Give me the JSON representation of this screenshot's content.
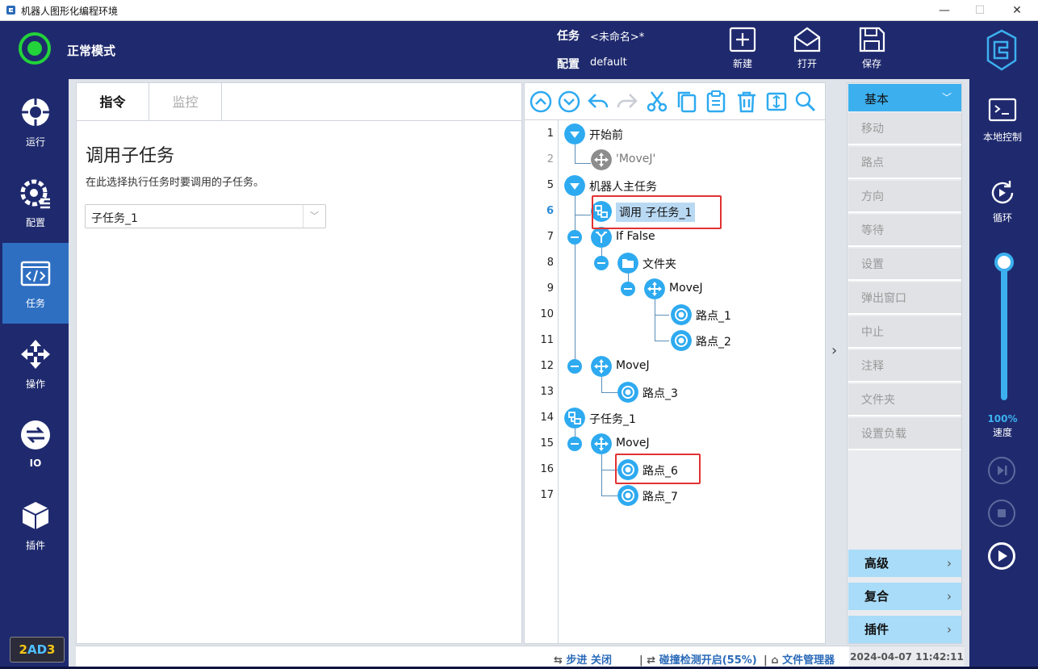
{
  "window": {
    "title": "机器人图形化编程环境",
    "minimize": "—",
    "maximize": "☐",
    "close": "✕"
  },
  "header": {
    "mode": "正常模式",
    "task_label": "任务",
    "task_value": "<未命名>*",
    "config_label": "配置",
    "config_value": "default",
    "buttons": [
      {
        "label": "新建",
        "icon": "new-file-icon"
      },
      {
        "label": "打开",
        "icon": "open-envelope-icon"
      },
      {
        "label": "保存",
        "icon": "save-disk-icon"
      }
    ]
  },
  "leftnav": {
    "items": [
      {
        "label": "运行",
        "icon": "run-icon"
      },
      {
        "label": "配置",
        "icon": "config-gear-icon"
      },
      {
        "label": "任务",
        "icon": "task-code-icon",
        "active": true
      },
      {
        "label": "操作",
        "icon": "move-arrows-icon"
      },
      {
        "label": "IO",
        "icon": "io-icon"
      },
      {
        "label": "插件",
        "icon": "plugin-cube-icon"
      }
    ],
    "badge_a": "2",
    "badge_b": "AD",
    "badge_c": "3"
  },
  "leftpanel": {
    "tabs": [
      "指令",
      "监控"
    ],
    "title": "调用子任务",
    "description": "在此选择执行任务时要调用的子任务。",
    "select_value": "子任务_1",
    "select_arrow": "﹀"
  },
  "tree": {
    "toolbar_icons": [
      "up-circle-icon",
      "down-circle-icon",
      "undo-icon",
      "redo-icon",
      "cut-icon",
      "copy-icon",
      "paste-icon",
      "delete-icon",
      "expand-icon",
      "search-icon"
    ],
    "lines": [
      {
        "num": "1",
        "label": "开始前"
      },
      {
        "num": "2",
        "label": "'MoveJ'"
      },
      {
        "num": "5",
        "label": "机器人主任务"
      },
      {
        "num": "6",
        "label": "调用 子任务_1"
      },
      {
        "num": "7",
        "label": "If  False"
      },
      {
        "num": "8",
        "label": "文件夹"
      },
      {
        "num": "9",
        "label": "MoveJ"
      },
      {
        "num": "10",
        "label": "路点_1"
      },
      {
        "num": "11",
        "label": "路点_2"
      },
      {
        "num": "12",
        "label": "MoveJ"
      },
      {
        "num": "13",
        "label": "路点_3"
      },
      {
        "num": "14",
        "label": "子任务_1"
      },
      {
        "num": "15",
        "label": "MoveJ"
      },
      {
        "num": "16",
        "label": "路点_6"
      },
      {
        "num": "17",
        "label": "路点_7"
      }
    ]
  },
  "collapse_arrow": "›",
  "categories": {
    "header": "基本",
    "header_arrow": "﹀",
    "items": [
      "移动",
      "路点",
      "方向",
      "等待",
      "设置",
      "弹出窗口",
      "中止",
      "注释",
      "文件夹",
      "设置负载"
    ],
    "groups": [
      "高级",
      "复合",
      "插件"
    ],
    "group_arrow": "›"
  },
  "rightbar": {
    "local_control": "本地控制",
    "loop": "循环",
    "speed_pct": "100%",
    "speed_label": "速度",
    "speed_value": 1.0
  },
  "statusbar": {
    "step": "步进 关闭",
    "collision": "碰撞检测开启(55%)",
    "file_mgr": "文件管理器",
    "datetime": "2024-04-07 11:42:11"
  },
  "colors": {
    "accent": "#2eaaf0",
    "nav_bg": "#1f2a6e",
    "active_nav": "#2e6fc2",
    "status_ok": "#22d33a",
    "highlight_box": "#e23232"
  }
}
